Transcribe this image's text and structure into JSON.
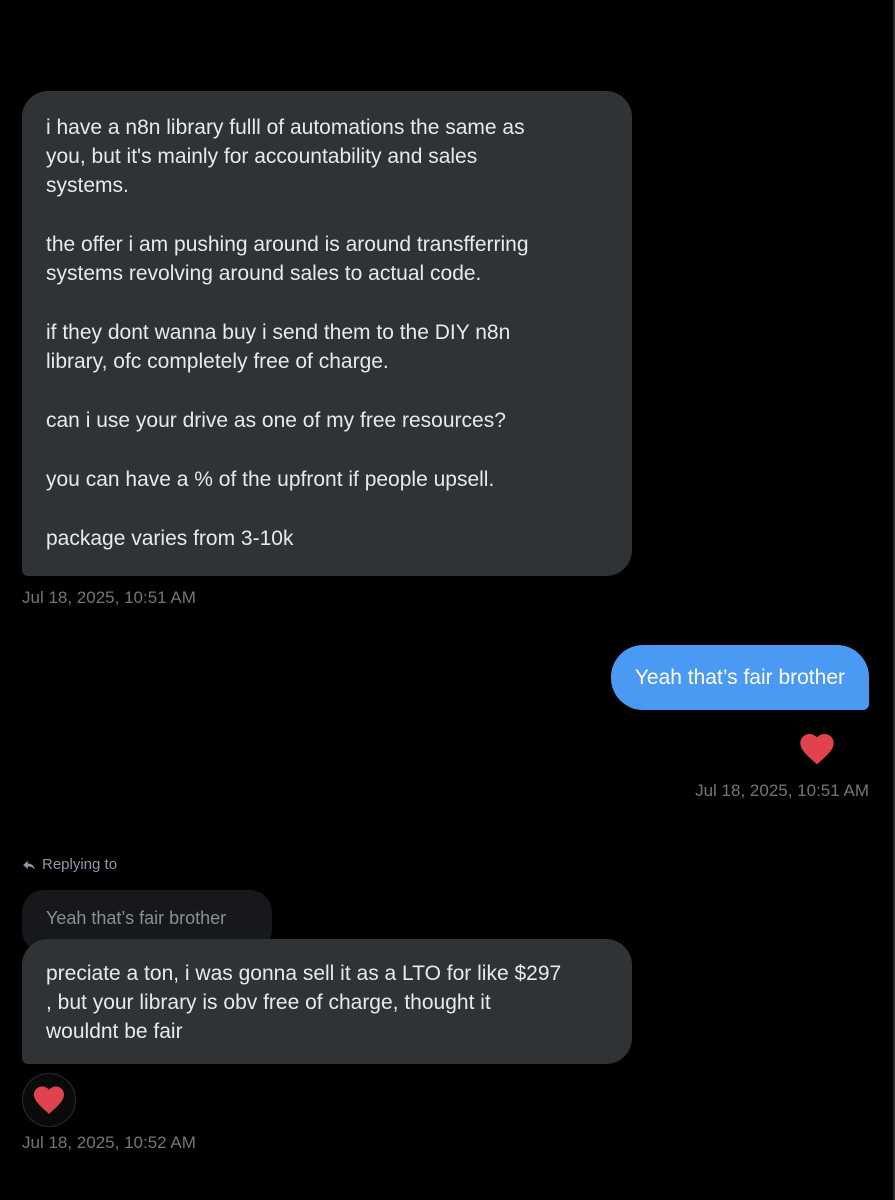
{
  "colors": {
    "background": "#000000",
    "incoming_bubble": "#2f3336",
    "outgoing_bubble": "#4a9af3",
    "heart": "#e0424e",
    "timestamp": "#71767b"
  },
  "messages": [
    {
      "direction": "incoming",
      "paragraphs": [
        "i have a n8n library fulll of automations the same as\nyou, but it's mainly for accountability and sales\nsystems.",
        "the offer i am pushing around is around transfferring\nsystems revolving around sales to actual code.",
        "if they dont wanna buy  i send them to the DIY n8n\nlibrary, ofc completely free of charge.",
        "can i use your drive as one of my free resources?",
        "you can have a % of the upfront if people upsell.",
        "package varies from 3-10k"
      ],
      "timestamp": "Jul 18, 2025, 10:51 AM"
    },
    {
      "direction": "outgoing",
      "text": "Yeah that’s fair brother",
      "reaction": "heart-icon",
      "timestamp": "Jul 18, 2025, 10:51 AM"
    },
    {
      "direction": "incoming",
      "reply_label": "Replying to",
      "quoted_text": "Yeah that’s fair brother",
      "text": "preciate a ton, i was gonna sell it as a LTO for like $297\n, but your library is obv free of charge, thought it\nwouldnt be fair",
      "reaction": "heart-icon",
      "timestamp": "Jul 18, 2025, 10:52 AM"
    }
  ]
}
